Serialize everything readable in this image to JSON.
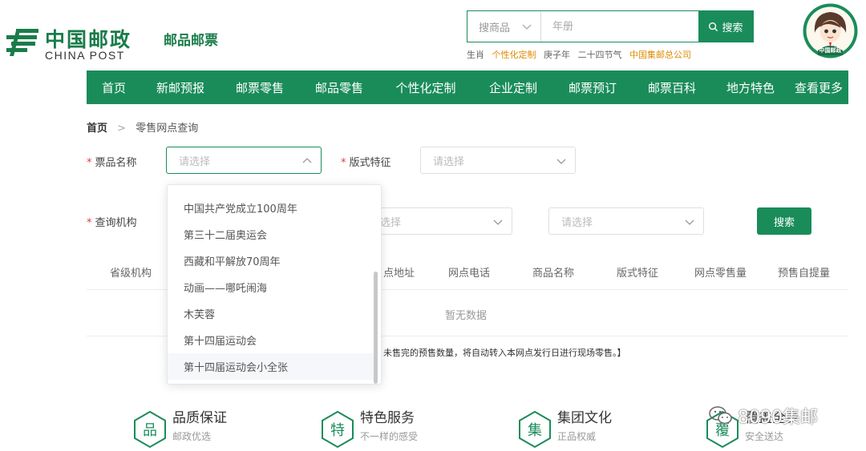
{
  "header": {
    "logo_cn": "中国邮政",
    "logo_en": "CHINA POST",
    "site_name": "邮品邮票",
    "search": {
      "category": "搜商品",
      "placeholder": "年册",
      "button": "搜索"
    },
    "hot_words": [
      {
        "text": "生肖",
        "color": "#666666"
      },
      {
        "text": "个性化定制",
        "color": "#e08a00"
      },
      {
        "text": "庚子年",
        "color": "#666666"
      },
      {
        "text": "二十四节气",
        "color": "#666666"
      },
      {
        "text": "中国集邮总公司",
        "color": "#e08a00"
      }
    ],
    "avatar_text": "中国邮政"
  },
  "nav": [
    "首页",
    "新邮预报",
    "邮票零售",
    "邮品零售",
    "个性化定制",
    "企业定制",
    "邮票预订",
    "邮票百科",
    "地方特色",
    "查看更多"
  ],
  "breadcrumb": {
    "home": "首页",
    "current": "零售网点查询"
  },
  "form": {
    "ticket_name_label": "票品名称",
    "ticket_name_placeholder": "请选择",
    "format_label": "版式特征",
    "format_placeholder": "请选择",
    "org_label": "查询机构",
    "org_placeholder_2": "请选择",
    "org_placeholder_3": "请选择",
    "search_button": "搜索"
  },
  "dropdown": {
    "items": [
      "中国共产党成立100周年",
      "第三十二届奥运会",
      "西藏和平解放70周年",
      "动画——哪吒闹海",
      "木芙蓉",
      "第十四届运动会",
      "第十四届运动会小全张"
    ],
    "hovered_index": 6
  },
  "table": {
    "headers": [
      "省级机构",
      "网点地址",
      "网点电话",
      "商品名称",
      "版式特征",
      "网点零售量",
      "预售自提量"
    ],
    "visible_header_fragment": "点地址",
    "empty_text": "暂无数据",
    "note": "未售完的预售数量，将自动转入本网点发行日进行现场零售。】"
  },
  "features": [
    {
      "icon": "品",
      "title": "品质保证",
      "sub": "邮政优选"
    },
    {
      "icon": "特",
      "title": "特色服务",
      "sub": "不一样的感受"
    },
    {
      "icon": "集",
      "title": "集团文化",
      "sub": "正品权威"
    },
    {
      "icon": "覆",
      "title": "覆盖全乡",
      "sub": "安全送达"
    }
  ],
  "watermark": "8090集邮",
  "colors": {
    "brand": "#1a8c5a",
    "accent": "#e08a00",
    "required": "#e4393c"
  }
}
